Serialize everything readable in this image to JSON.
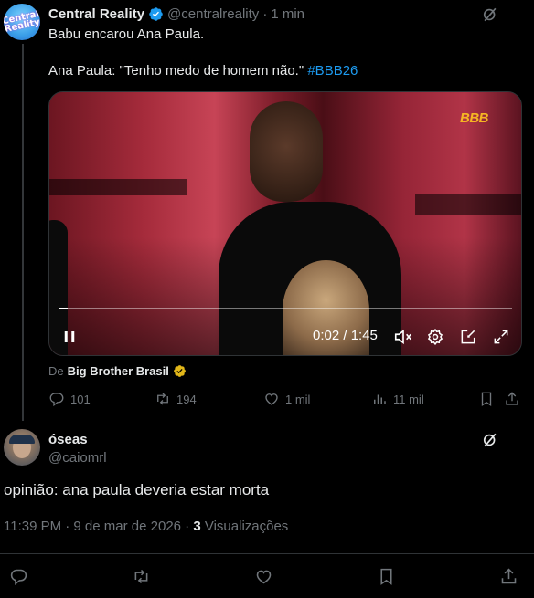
{
  "parent_tweet": {
    "avatar_text": "Central Reality",
    "display_name": "Central Reality",
    "handle": "@centralreality",
    "separator": "·",
    "time_ago": "1 min",
    "text_line1": "Babu encarou Ana Paula.",
    "text_line2": "Ana Paula: \"Tenho medo de homem não.\"",
    "hashtag": "#BBB26",
    "video": {
      "logo": "BBB",
      "time_display": "0:02 / 1:45",
      "progress_fraction": 0.02
    },
    "from_label": "De",
    "from_source": "Big Brother Brasil",
    "metrics": {
      "replies": "101",
      "reposts": "194",
      "likes": "1 mil",
      "views": "11 mil"
    }
  },
  "main_tweet": {
    "display_name": "óseas",
    "handle": "@caiomrl",
    "text": "opinião: ana paula deveria estar morta",
    "timestamp": "11:39 PM · 9 de mar de 2026 · ",
    "views_count": "3",
    "views_label": " Visualizações"
  },
  "icons": {
    "verified": "verified-badge-icon",
    "verified_gold": "gold-verified-badge-icon",
    "grok": "grok-icon",
    "reply": "reply-icon",
    "repost": "repost-icon",
    "like": "like-icon",
    "views": "views-icon",
    "bookmark": "bookmark-icon",
    "share": "share-icon",
    "pause": "pause-icon",
    "mute": "mute-icon",
    "settings": "settings-icon",
    "pip": "picture-in-picture-icon",
    "fullscreen": "fullscreen-icon"
  },
  "colors": {
    "background": "#000000",
    "text": "#e7e9ea",
    "muted": "#71767b",
    "accent": "#1d9bf0",
    "gold": "#f5b723"
  }
}
